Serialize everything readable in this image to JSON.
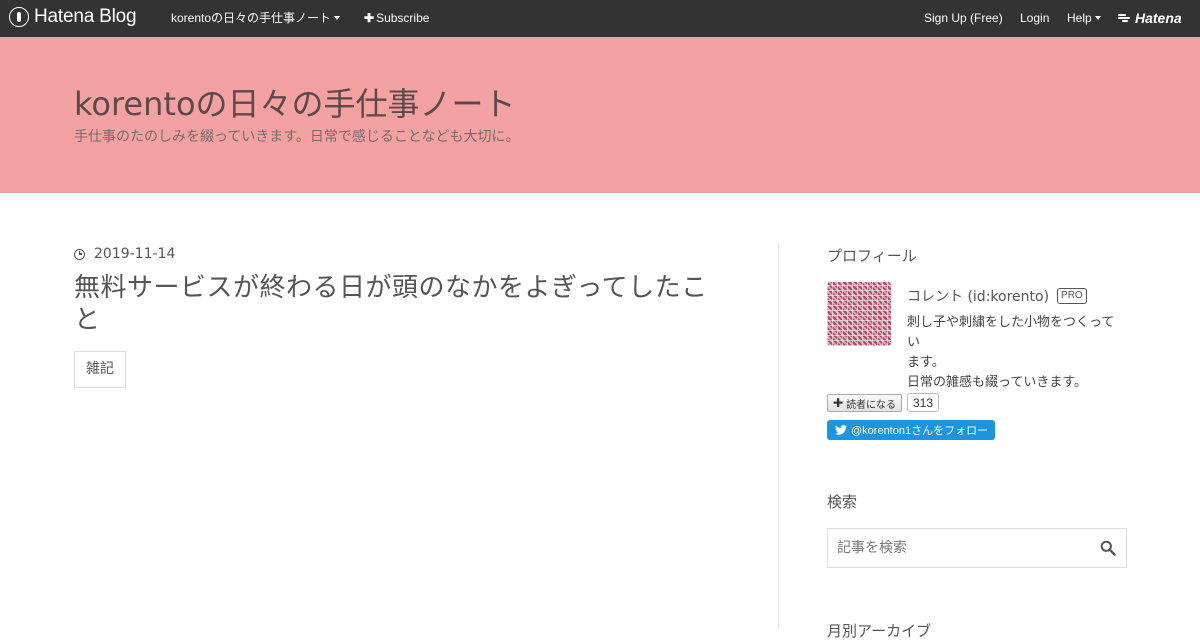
{
  "topbar": {
    "logo_text": "Hatena Blog",
    "blog_menu_label": "korentoの日々の手仕事ノート",
    "subscribe_label": "Subscribe",
    "signup_label": "Sign Up (Free)",
    "login_label": "Login",
    "help_label": "Help",
    "brand_label": "Hatena"
  },
  "header": {
    "title": "korentoの日々の手仕事ノート",
    "description": "手仕事のたのしみを綴っていきます。日常で感じることなども大切に。"
  },
  "entry": {
    "date": "2019-11-14",
    "title": "無料サービスが終わる日が頭のなかをよぎってしたこと",
    "category": "雑記"
  },
  "sidebar": {
    "profile_heading": "プロフィール",
    "profile_name": "コレント (id:korento)",
    "pro_badge": "PRO",
    "bio": [
      "刺し子や刺繍をした小物をつくってい",
      "ます。",
      "日常の雑感も綴っていきます。"
    ],
    "subscribe_button": "読者になる",
    "subscriber_count": "313",
    "twitter_follow": "@korenton1さんをフォロー",
    "search_heading": "検索",
    "search_placeholder": "記事を検索",
    "archive_heading": "月別アーカイブ"
  },
  "colors": {
    "topbar": "#333333",
    "header_bg": "#f4a1a1",
    "twitter_blue": "#1b95e0"
  },
  "icons": [
    "hatena-blog-logo-icon",
    "caret-down-icon",
    "plus-icon",
    "hatena-brand-icon",
    "clock-icon",
    "plus-icon",
    "twitter-bird-icon",
    "search-icon"
  ]
}
